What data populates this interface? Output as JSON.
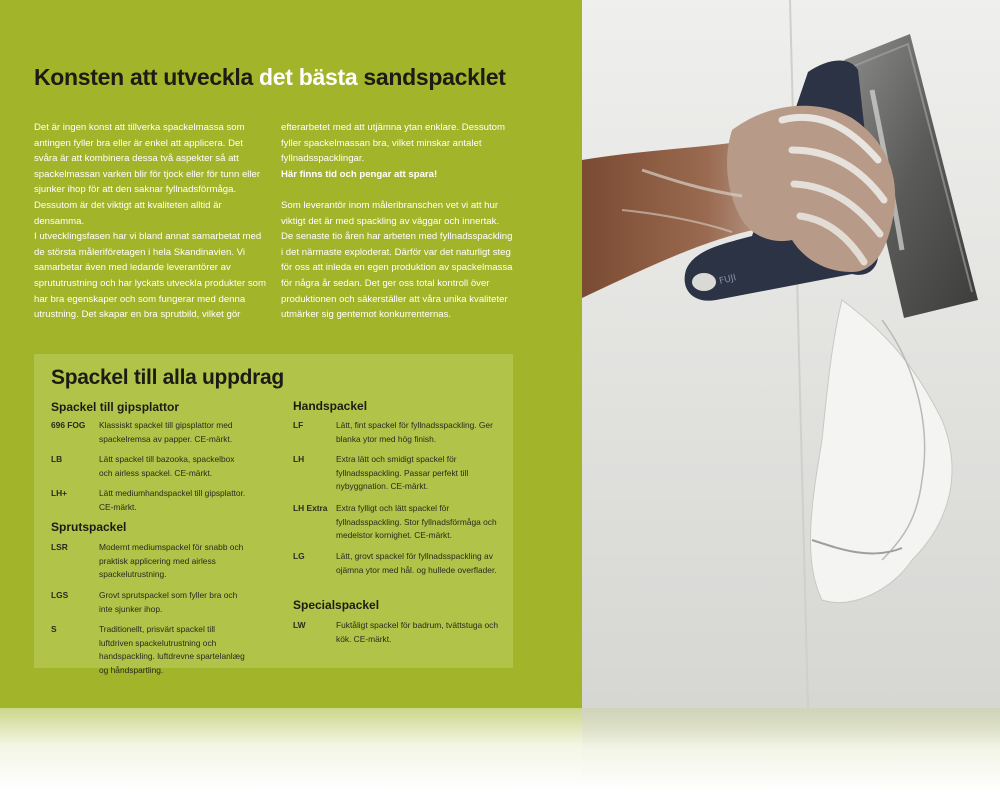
{
  "headline": {
    "part1": "Konsten att utveckla ",
    "highlight": "det bästa",
    "part2": " sandspacklet"
  },
  "body_left": [
    "Det är ingen konst att tillverka spackelmassa som antingen fyller bra eller är enkel att applicera. Det svåra är att kombinera dessa två aspekter så att spackelmassan varken blir för tjock eller för tunn eller sjunker ihop för att den saknar fyllnadsförmåga. Dessutom är det viktigt att kvaliteten alltid är densamma.",
    "I utvecklingsfasen har vi bland annat samarbetat med de största måleriföretagen i hela Skandinavien. Vi samarbetar även med ledande leverantörer av sprututrustning och har lyckats utveckla produkter som har bra egenskaper och som fungerar med denna utrustning. Det skapar en bra sprutbild, vilket gör"
  ],
  "body_right": {
    "p1": "efterarbetet med att utjämna ytan enklare. Dessutom fyller spackelmassan bra, vilket minskar antalet fyllnadsspacklingar.",
    "p1_strong": "Här finns tid och pengar att spara!",
    "p2": "Som leverantör inom måleribranschen vet vi att hur viktigt det är med spackling av väggar och innertak. De senaste tio åren har arbeten med fyllnadsspackling i det närmaste exploderat. Därför var det naturligt steg för oss att inleda en egen produktion av spackelmassa för några år sedan. Det ger oss total kontroll över produktionen och säkerställer att våra unika kvaliteter utmärker sig gentemot konkurrenternas."
  },
  "panel": {
    "title": "Spackel till alla uppdrag",
    "left_sections": [
      {
        "heading": "Spackel till gipsplattor",
        "items": [
          {
            "code": "696 FOG",
            "desc": "Klassiskt spackel till gipsplattor med spackelremsa av papper. CE-märkt."
          },
          {
            "code": "LB",
            "desc": "Lätt spackel till bazooka, spackelbox och airless spackel. CE-märkt."
          },
          {
            "code": "LH+",
            "desc": "Lätt mediumhandspackel till gipsplattor. CE-märkt."
          }
        ]
      },
      {
        "heading": "Sprutspackel",
        "items": [
          {
            "code": "LSR",
            "desc": "Modernt mediumspackel för snabb och praktisk applicering med airless spackelutrustning."
          },
          {
            "code": "LGS",
            "desc": "Grovt sprutspackel som fyller bra och inte sjunker ihop."
          },
          {
            "code": "S",
            "desc": "Traditionellt, prisvärt spackel till luftdriven spackelutrustning och handspackling. luftdrevne spartelanlæg og håndspartling."
          }
        ]
      }
    ],
    "right_sections": [
      {
        "heading": "Handspackel",
        "items": [
          {
            "code": "LF",
            "desc": "Lätt, fint spackel för fyllnadsspackling. Ger blanka ytor med hög finish."
          },
          {
            "code": "LH",
            "desc": "Extra lätt och smidigt spackel för fyllnadsspackling. Passar perfekt till nybyggnation. CE-märkt."
          },
          {
            "code": "LH Extra",
            "desc": "Extra fylligt och lätt spackel för fyllnadsspackling. Stor fyllnadsförmåga och medelstor kornighet. CE-märkt."
          },
          {
            "code": "LG",
            "desc": "Lätt, grovt spackel för fyllnadsspackling av ojämna ytor med hål. og hullede overflader."
          }
        ]
      },
      {
        "heading": "Specialspackel",
        "items": [
          {
            "code": "LW",
            "desc": "Fuktåligt spackel för badrum, tvättstuga och kök. CE-märkt."
          }
        ]
      }
    ]
  },
  "colors": {
    "page_green": "#a2b52a",
    "panel_green": "#b1c449",
    "text_dark": "#1c1c14",
    "wall_grey": "#e6e6e4"
  },
  "photo": {
    "icon": "hand-with-spatula-photo"
  }
}
